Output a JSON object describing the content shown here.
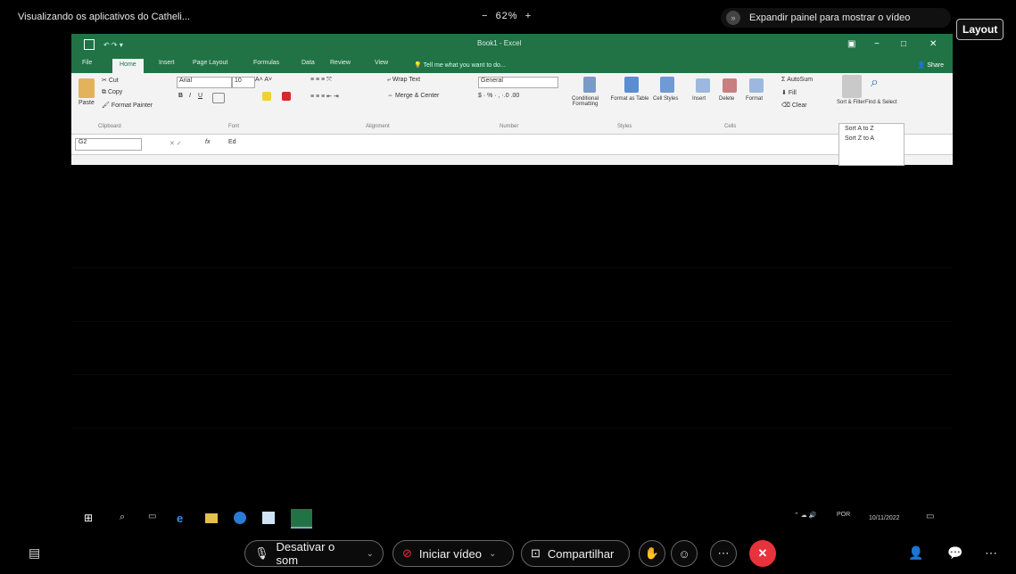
{
  "topbar": {
    "viewing_label": "Visualizando os aplicativos do Catheli...",
    "zoom_minus": "−",
    "zoom_value": "62%",
    "zoom_plus": "+",
    "expand_label": "Expandir painel para mostrar o vídeo",
    "layout_button": "Layout"
  },
  "excel": {
    "title": "Book1 - Excel",
    "window_controls": [
      "−",
      "□",
      "✕"
    ],
    "tabs": [
      "File",
      "Home",
      "Insert",
      "Page Layout",
      "Formulas",
      "Data",
      "Review",
      "View"
    ],
    "active_tab": "Home",
    "tell_me": "Tell me what you want to do...",
    "share": "Share",
    "clipboard": {
      "cut": "Cut",
      "copy": "Copy",
      "format_painter": "Format Painter",
      "paste": "Paste",
      "group": "Clipboard"
    },
    "font": {
      "name": "Arial",
      "size": "10",
      "bold": "B",
      "italic": "I",
      "underline": "U",
      "group": "Font"
    },
    "alignment": {
      "wrap_text": "Wrap Text",
      "merge_center": "Merge & Center",
      "group": "Alignment"
    },
    "number": {
      "format": "General",
      "group": "Number"
    },
    "styles": {
      "conditional": "Conditional Formatting",
      "format_table": "Format as Table",
      "cell_styles": "Cell Styles",
      "group": "Styles"
    },
    "cells": {
      "insert": "Insert",
      "delete": "Delete",
      "format": "Format",
      "group": "Cells"
    },
    "editing": {
      "autosum": "AutoSum",
      "fill": "Fill",
      "clear": "Clear",
      "sort_filter": "Sort & Filter",
      "find_select": "Find & Select"
    },
    "sort_menu": [
      "Sort A to Z",
      "Sort Z to A"
    ],
    "namebox": "G2",
    "formula_fx": "fx",
    "formula_value": "Ed"
  },
  "taskbar": {
    "tray_lang": "POR",
    "tray_date": "10/11/2022"
  },
  "meeting": {
    "mute_label": "Desativar o som",
    "video_label": "Iniciar vídeo",
    "share_label": "Compartilhar",
    "colors": {
      "end_call": "#e8323c",
      "excel_green": "#217346"
    }
  }
}
